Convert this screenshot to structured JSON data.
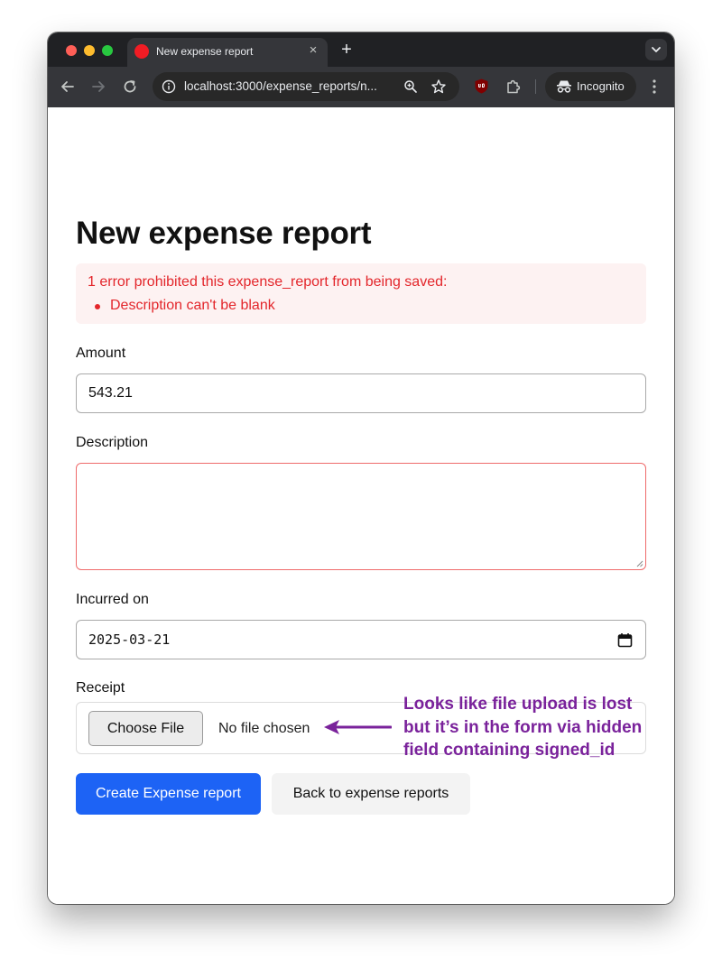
{
  "browser": {
    "tab_title": "New expense report",
    "tab_close": "×",
    "new_tab": "+",
    "url": "localhost:3000/expense_reports/n...",
    "incognito_label": "Incognito"
  },
  "page": {
    "title": "New expense report",
    "error": {
      "heading": "1 error prohibited this expense_report from being saved:",
      "items": [
        "Description can't be blank"
      ]
    },
    "fields": {
      "amount": {
        "label": "Amount",
        "value": "543.21"
      },
      "description": {
        "label": "Description",
        "value": ""
      },
      "incurred_on": {
        "label": "Incurred on",
        "value": "2025-03-21"
      },
      "receipt": {
        "label": "Receipt",
        "button": "Choose File",
        "status": "No file chosen"
      }
    },
    "actions": {
      "submit": "Create Expense report",
      "back": "Back to expense reports"
    }
  },
  "annotation": {
    "lines": [
      "Looks like file upload is lost",
      "but it’s in the form via hidden",
      "field containing signed_id"
    ],
    "color": "#7a229b"
  },
  "colors": {
    "primary": "#1d63f5",
    "error": "#e3262b",
    "error_bg": "#fdf2f2"
  }
}
